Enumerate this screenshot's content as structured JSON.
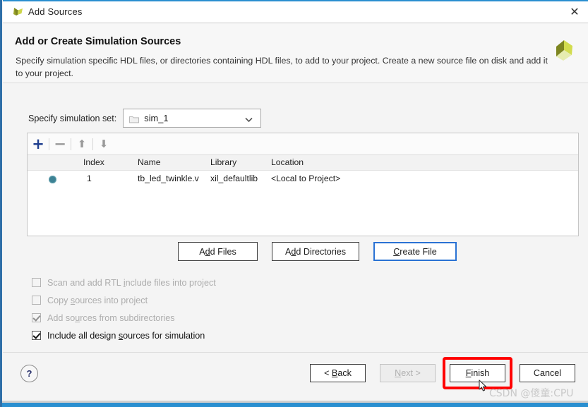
{
  "window": {
    "title": "Add Sources",
    "close_label": "✕",
    "logo_icon": "vivado-logo-icon"
  },
  "header": {
    "title": "Add or Create Simulation Sources",
    "description": "Specify simulation specific HDL files, or directories containing HDL files, to add to your project. Create a new source file on disk and add it to your project.",
    "logo_icon": "xilinx-logo-icon"
  },
  "simulation_set": {
    "label": "Specify simulation set:",
    "value": "sim_1",
    "folder_icon": "folder-icon",
    "chevron_icon": "chevron-down-icon"
  },
  "file_table": {
    "toolbar": {
      "add_label": "+",
      "remove_label": "−",
      "move_up_label": "⬆",
      "move_down_label": "⬇"
    },
    "columns": [
      "Index",
      "Name",
      "Library",
      "Location"
    ],
    "rows": [
      {
        "status_icon": "file-status-icon",
        "index": "1",
        "name": "tb_led_twinkle.v",
        "library": "xil_defaultlib",
        "location": "<Local to Project>"
      }
    ]
  },
  "actions": {
    "add_files": "Add Files",
    "add_directories": "Add Directories",
    "create_file": "Create File"
  },
  "options": [
    {
      "label": "Scan and add RTL include files into project",
      "checked": false,
      "enabled": false
    },
    {
      "label": "Copy sources into project",
      "checked": false,
      "enabled": false
    },
    {
      "label": "Add sources from subdirectories",
      "checked": true,
      "enabled": false
    },
    {
      "label": "Include all design sources for simulation",
      "checked": true,
      "enabled": true
    }
  ],
  "footer": {
    "help_label": "?",
    "back_label": "< Back",
    "next_label": "Next >",
    "finish_label": "Finish",
    "cancel_label": "Cancel",
    "highlight_color": "#ff0000"
  },
  "watermark": {
    "text": "CSDN @傻童:CPU"
  }
}
